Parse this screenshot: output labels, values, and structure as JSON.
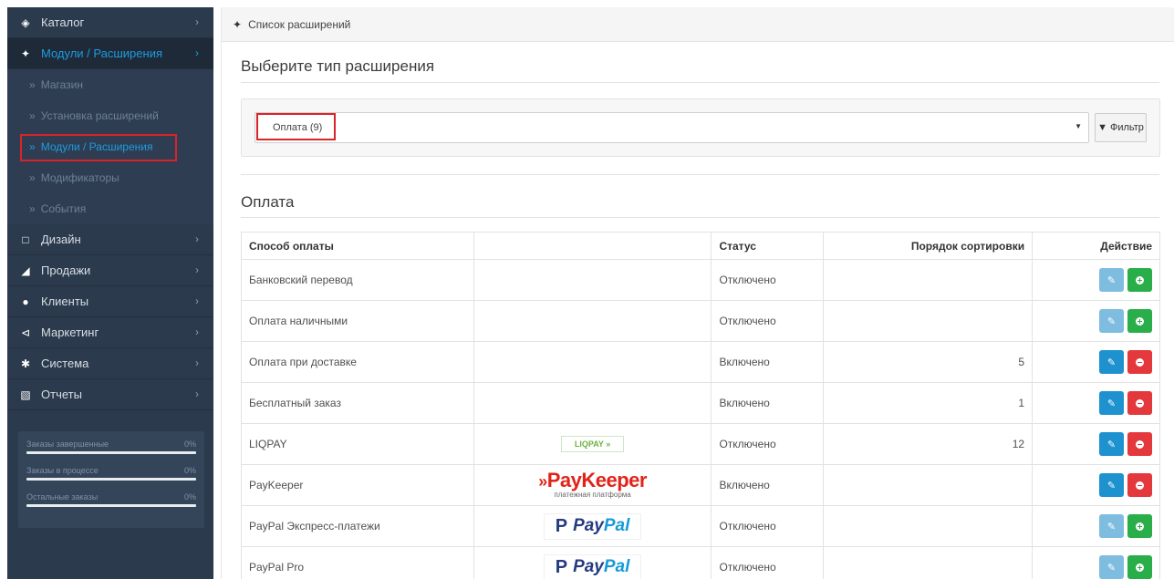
{
  "sidebar": {
    "items": [
      {
        "label": "Каталог",
        "icon": "tag-icon"
      },
      {
        "label": "Модули / Расширения",
        "icon": "puzzle-icon",
        "active": true
      },
      {
        "label": "Дизайн",
        "icon": "monitor-icon"
      },
      {
        "label": "Продажи",
        "icon": "cart-icon"
      },
      {
        "label": "Клиенты",
        "icon": "user-icon"
      },
      {
        "label": "Маркетинг",
        "icon": "share-icon"
      },
      {
        "label": "Система",
        "icon": "gear-icon"
      },
      {
        "label": "Отчеты",
        "icon": "bar-chart-icon"
      }
    ],
    "submenu": [
      {
        "label": "Магазин"
      },
      {
        "label": "Установка расширений"
      },
      {
        "label": "Модули / Расширения",
        "current": true
      },
      {
        "label": "Модификаторы"
      },
      {
        "label": "События"
      }
    ],
    "stats": [
      {
        "label": "Заказы завершенные",
        "value": "0%"
      },
      {
        "label": "Заказы в процессе",
        "value": "0%"
      },
      {
        "label": "Остальные заказы",
        "value": "0%"
      }
    ]
  },
  "header": {
    "breadcrumb": "Список расширений"
  },
  "main": {
    "choose_title": "Выберите тип расширения",
    "select_value": "Оплата (9)",
    "filter_label": "Фильтр",
    "section_title": "Оплата"
  },
  "table": {
    "headers": [
      "Способ оплаты",
      "",
      "Статус",
      "Порядок сортировки",
      "Действие"
    ],
    "rows": [
      {
        "name": "Банковский перевод",
        "logo": "",
        "status": "Отключено",
        "sort": "",
        "installed": false
      },
      {
        "name": "Оплата наличными",
        "logo": "",
        "status": "Отключено",
        "sort": "",
        "installed": false
      },
      {
        "name": "Оплата при доставке",
        "logo": "",
        "status": "Включено",
        "sort": "5",
        "installed": true
      },
      {
        "name": "Бесплатный заказ",
        "logo": "",
        "status": "Включено",
        "sort": "1",
        "installed": true
      },
      {
        "name": "LIQPAY",
        "logo": "liqpay",
        "status": "Отключено",
        "sort": "12",
        "installed": true
      },
      {
        "name": "PayKeeper",
        "logo": "paykeeper",
        "status": "Включено",
        "sort": "",
        "installed": true
      },
      {
        "name": "PayPal Экспресс-платежи",
        "logo": "paypal",
        "status": "Отключено",
        "sort": "",
        "installed": false
      },
      {
        "name": "PayPal Pro",
        "logo": "paypal",
        "status": "Отключено",
        "sort": "",
        "installed": false
      }
    ]
  },
  "logos": {
    "liqpay": "LIQPAY",
    "paykeeper_name": "PayKeeper",
    "paykeeper_sub": "платежная платформа",
    "paypal_pay": "Pay",
    "paypal_pal": "Pal"
  },
  "colors": {
    "sidebar_bg": "#2b3a4c",
    "accent_blue": "#1e91cf",
    "install_green": "#2aae4a",
    "remove_red": "#e3393c",
    "highlight_red": "#d9232a"
  }
}
